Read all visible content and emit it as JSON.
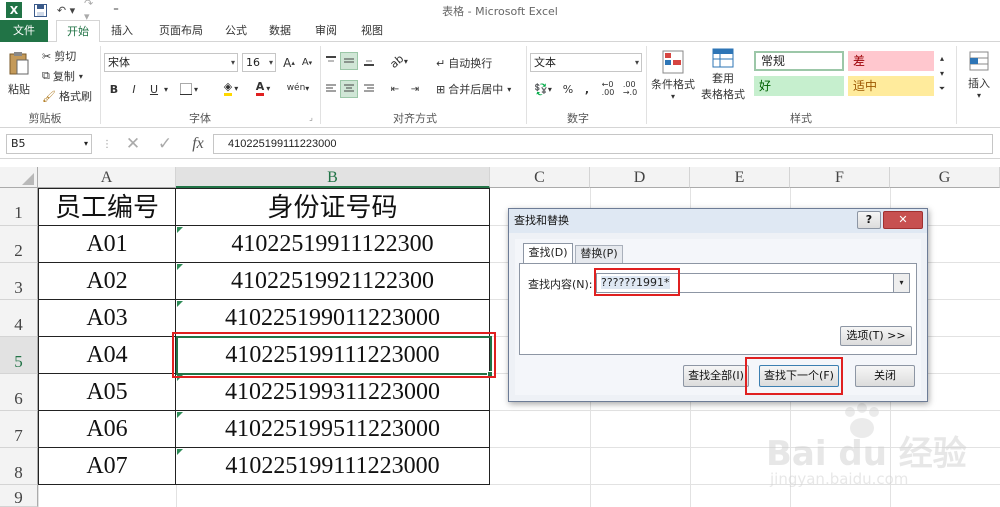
{
  "window": {
    "title": "表格 - Microsoft Excel"
  },
  "ribbon_tabs": [
    "文件",
    "开始",
    "插入",
    "页面布局",
    "公式",
    "数据",
    "审阅",
    "视图"
  ],
  "clipboard": {
    "paste": "粘贴",
    "cut": "剪切",
    "copy": "复制",
    "format_painter": "格式刷",
    "group": "剪贴板"
  },
  "font": {
    "name": "宋体",
    "size": "16",
    "group": "字体",
    "bold": "B",
    "italic": "I",
    "underline": "U",
    "grow": "A",
    "shrink": "A",
    "color_letter": "A",
    "font_color_hex": "#e02020",
    "fill_color_hex": "#ffd800"
  },
  "alignment": {
    "wrap": "自动换行",
    "merge": "合并后居中",
    "group": "对齐方式"
  },
  "number": {
    "format": "文本",
    "percent": "%",
    "comma": ",",
    "group": "数字"
  },
  "styles": {
    "conditional": "条件格式",
    "table_format_1": "套用",
    "table_format_2": "表格格式",
    "normal": "常规",
    "bad": "差",
    "good": "好",
    "neutral": "适中",
    "group": "样式"
  },
  "cells": {
    "insert": "插入"
  },
  "formula_bar": {
    "name_box": "B5",
    "fx": "fx",
    "content": "410225199111223000"
  },
  "columns": [
    "A",
    "B",
    "C",
    "D",
    "E",
    "F",
    "G"
  ],
  "rows": [
    "1",
    "2",
    "3",
    "4",
    "5",
    "6",
    "7",
    "8",
    "9"
  ],
  "table": {
    "header": [
      "员工编号",
      "身份证号码"
    ],
    "data": [
      [
        "A01",
        "41022519911122300"
      ],
      [
        "A02",
        "41022519921122300"
      ],
      [
        "A03",
        "410225199011223000"
      ],
      [
        "A04",
        "410225199111223000"
      ],
      [
        "A05",
        "410225199311223000"
      ],
      [
        "A06",
        "410225199511223000"
      ],
      [
        "A07",
        "410225199111223000"
      ]
    ]
  },
  "dialog": {
    "title": "查找和替换",
    "help": "?",
    "close": "✕",
    "tab_find": "查找(D)",
    "tab_replace": "替换(P)",
    "find_label": "查找内容(N):",
    "find_value": "??????1991*",
    "options": "选项(T) >>",
    "find_all": "查找全部(I)",
    "find_next": "查找下一个(F)",
    "close_btn": "关闭"
  },
  "colors": {
    "excel_green": "#217346",
    "highlight_red": "#e02020"
  },
  "watermark": {
    "brand": "Bai du 经验",
    "url": "jingyan.baidu.com"
  }
}
